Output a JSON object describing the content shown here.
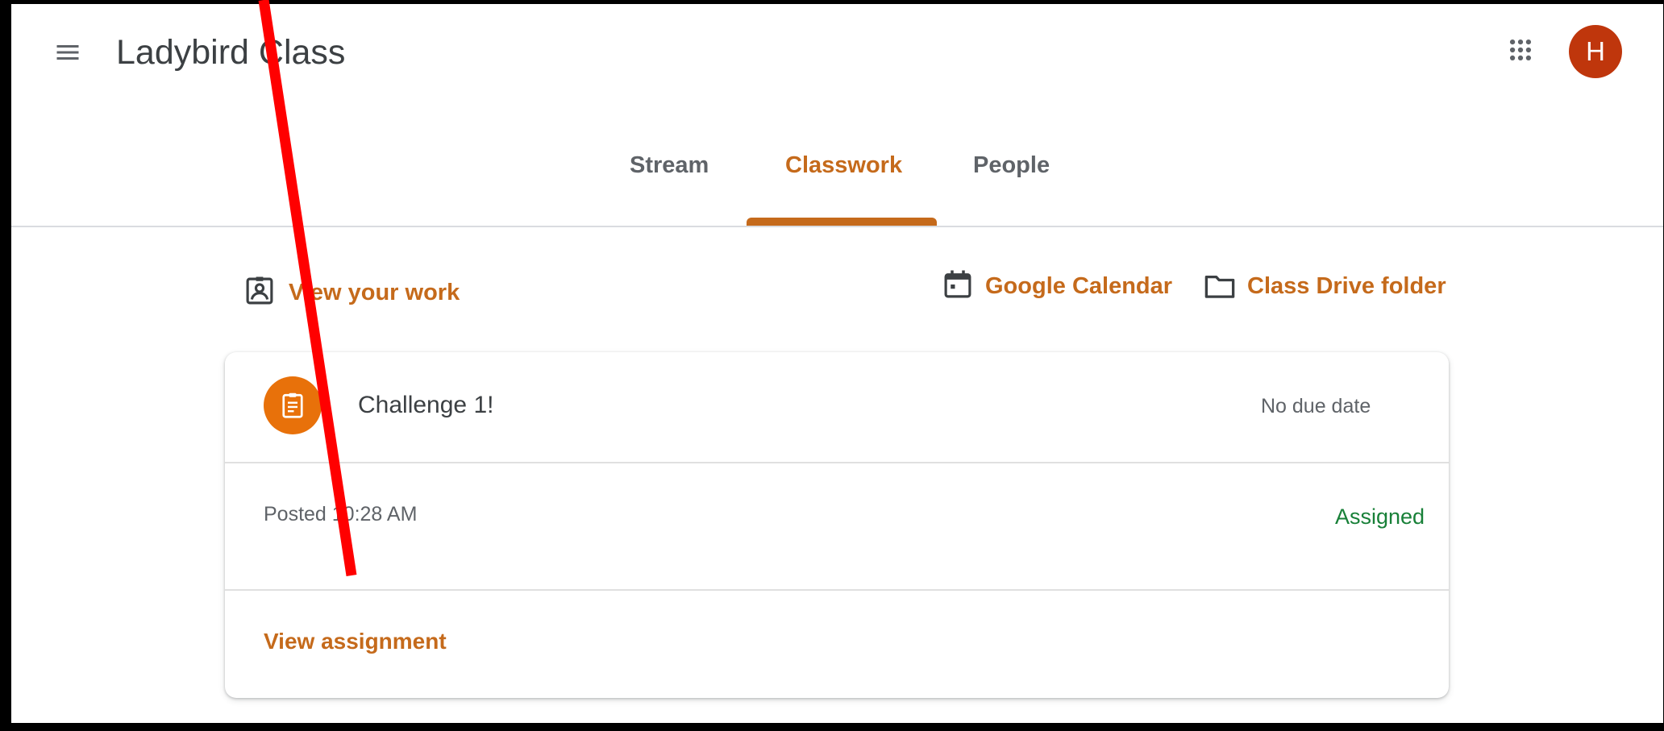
{
  "header": {
    "class_name": "Ladybird Class",
    "avatar_letter": "H",
    "menu_icon": "hamburger-menu-icon",
    "apps_icon": "apps-grid-icon"
  },
  "tabs": [
    {
      "label": "Stream",
      "active": false
    },
    {
      "label": "Classwork",
      "active": true
    },
    {
      "label": "People",
      "active": false
    }
  ],
  "toolbar": {
    "view_work": "View your work",
    "google_calendar": "Google Calendar",
    "drive_folder": "Class Drive folder"
  },
  "assignment": {
    "title": "Challenge 1!",
    "due": "No due date",
    "posted": "Posted 10:28 AM",
    "status": "Assigned",
    "view_link": "View assignment",
    "icon": "assignment-icon"
  },
  "colors": {
    "accent": "#c56a1b",
    "assignment_icon_bg": "#e8710a",
    "status_green": "#188038",
    "avatar_bg": "#bf360c",
    "annotation_red": "#ff0000"
  }
}
